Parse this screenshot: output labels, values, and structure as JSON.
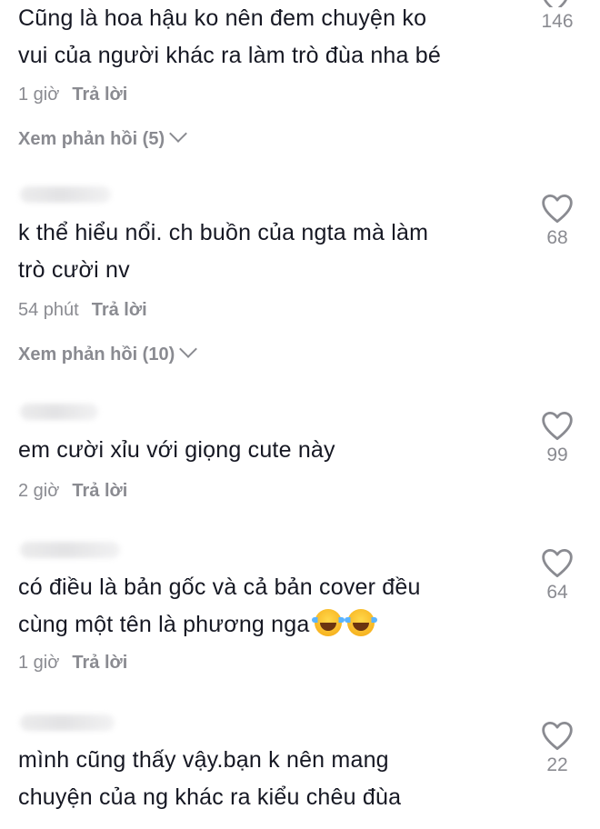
{
  "comments": [
    {
      "text": "Cũng là hoa hậu ko nên đem chuyện ko\nvui của người khác ra làm trò đùa nha bé",
      "time": "1 giờ",
      "reply_label": "Trả lời",
      "view_replies": "Xem phản hồi (5)",
      "likes": "146"
    },
    {
      "text": "k thể hiểu nổi. ch buồn của ngta mà làm\ntrò cười nv",
      "time": "54 phút",
      "reply_label": "Trả lời",
      "view_replies": "Xem phản hồi (10)",
      "likes": "68"
    },
    {
      "text": "em cười xỉu với giọng cute này",
      "time": "2 giờ",
      "reply_label": "Trả lời",
      "likes": "99"
    },
    {
      "text": "có điều là bản gốc và cả bản cover đều\ncùng một tên là phương nga",
      "emoji": "face-with-tears-of-joy",
      "time": "1 giờ",
      "reply_label": "Trả lời",
      "likes": "64"
    },
    {
      "text": "mình cũng thấy vậy.bạn k nên mang\nchuyện của ng khác ra kiểu chêu đùa",
      "likes": "22"
    }
  ],
  "icons": {
    "like": "heart-outline-icon",
    "expand": "chevron-down-icon"
  },
  "colors": {
    "text": "#161823",
    "secondary": "#8a8b91",
    "background": "#ffffff"
  }
}
